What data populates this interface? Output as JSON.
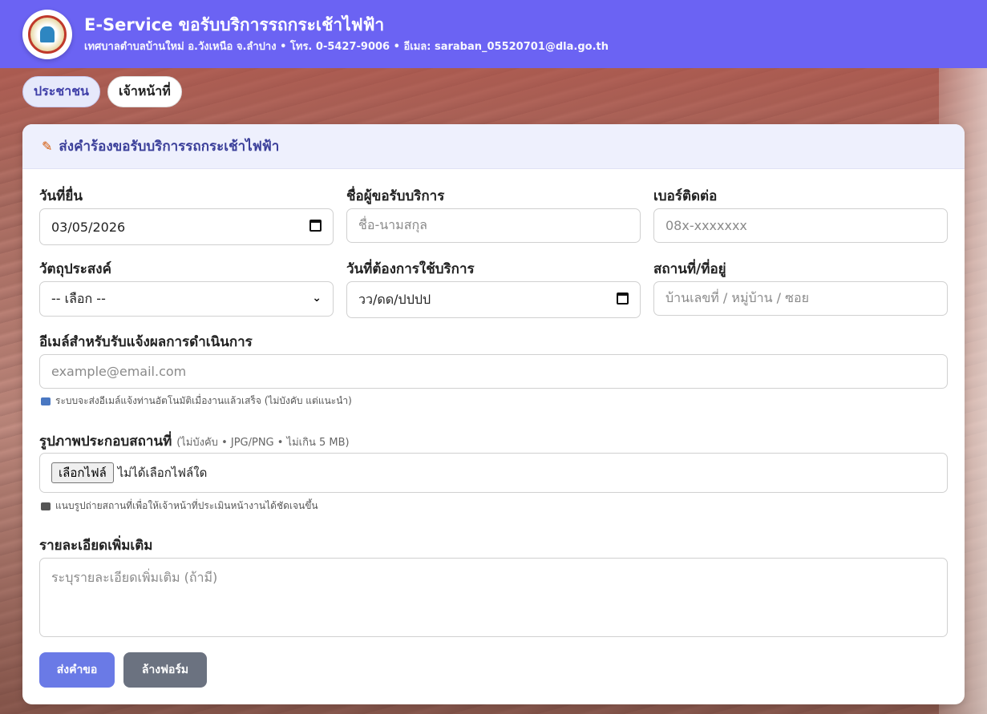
{
  "header": {
    "title": "E-Service ขอรับบริการรถกระเช้าไฟฟ้า",
    "subtitle": "เทศบาลตำบลบ้านใหม่ อ.วังเหนือ จ.ลำปาง • โทร. 0-5427-9006 • อีเมล: saraban_05520701@dla.go.th"
  },
  "tabs": [
    {
      "label": "ประชาชน",
      "active": true
    },
    {
      "label": "เจ้าหน้าที่",
      "active": false
    }
  ],
  "form": {
    "title": "ส่งคำร้องขอรับบริการรถกระเช้าไฟฟ้า",
    "request_date": {
      "label": "วันที่ยื่น",
      "value": "03/05/2026"
    },
    "requester_name": {
      "label": "ชื่อผู้ขอรับบริการ",
      "placeholder": "ชื่อ-นามสกุล"
    },
    "phone": {
      "label": "เบอร์ติดต่อ",
      "placeholder": "08x-xxxxxxx"
    },
    "purpose": {
      "label": "วัตถุประสงค์",
      "selected": "-- เลือก --"
    },
    "service_date": {
      "label": "วันที่ต้องการใช้บริการ",
      "value": "วว/ดด/ปปปป"
    },
    "location": {
      "label": "สถานที่/ที่อยู่",
      "placeholder": "บ้านเลขที่ / หมู่บ้าน / ซอย"
    },
    "email": {
      "label": "อีเมล์สำหรับรับแจ้งผลการดำเนินการ",
      "placeholder": "example@email.com",
      "hint": "ระบบจะส่งอีเมล์แจ้งท่านอัตโนมัติเมื่องานแล้วเสร็จ (ไม่บังคับ แต่แนะนำ)"
    },
    "photo": {
      "label": "รูปภาพประกอบสถานที่",
      "note": "(ไม่บังคับ • JPG/PNG • ไม่เกิน 5 MB)",
      "button": "เลือกไฟล์",
      "status": "ไม่ได้เลือกไฟล์ใด",
      "hint": "แนบรูปถ่ายสถานที่เพื่อให้เจ้าหน้าที่ประเมินหน้างานได้ชัดเจนขึ้น"
    },
    "details": {
      "label": "รายละเอียดเพิ่มเติม",
      "placeholder": "ระบุรายละเอียดเพิ่มเติม (ถ้ามี)"
    },
    "submit_label": "ส่งคำขอ",
    "reset_label": "ล้างฟอร์ม"
  },
  "colors": {
    "header_bg": "#6b63f3",
    "primary_button": "#6a7ae6",
    "secondary_button": "#6b7280",
    "card_head_bg": "#eef0fd"
  }
}
